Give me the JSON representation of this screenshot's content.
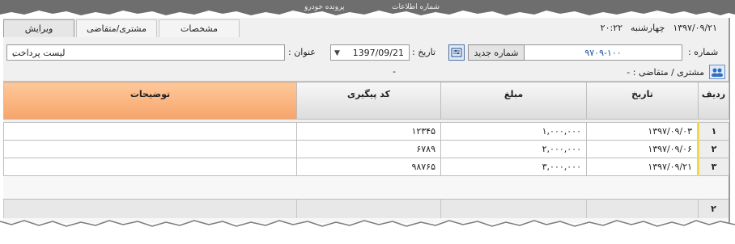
{
  "top_tabs": [
    "پرونده خودرو",
    "شماره اطلاعات"
  ],
  "tabs": [
    {
      "label": "ویرایش",
      "active": true
    },
    {
      "label": "مشتری/متقاضی",
      "active": false
    },
    {
      "label": "مشخصات",
      "active": false
    }
  ],
  "datetime": {
    "time": "۲۰:۲۲",
    "day": "چهارشنبه",
    "date": "۱۳۹۷/۰۹/۲۱"
  },
  "form": {
    "number_label": "شماره :",
    "number_value": "۹۷۰۹-۱۰۰",
    "new_number_button": "شماره جدید",
    "date_label": "تاریخ :",
    "date_value": "1397/09/21",
    "title_label": "عنوان :",
    "title_value": "لیست پرداخت",
    "customer_label": "مشتری / متقاضی : -",
    "dash": "-"
  },
  "grid": {
    "columns": [
      "ردیف",
      "تاریخ",
      "مبلغ",
      "کد پیگیری",
      "توضیحات"
    ],
    "rows": [
      {
        "n": "۱",
        "date": "۱۳۹۷/۰۹/۰۳",
        "amount": "۱,۰۰۰,۰۰۰",
        "code": "۱۲۳۴۵",
        "desc": ""
      },
      {
        "n": "۲",
        "date": "۱۳۹۷/۰۹/۰۶",
        "amount": "۲,۰۰۰,۰۰۰",
        "code": "۶۷۸۹",
        "desc": ""
      },
      {
        "n": "۳",
        "date": "۱۳۹۷/۰۹/۲۱",
        "amount": "۳,۰۰۰,۰۰۰",
        "code": "۹۸۷۶۵",
        "desc": ""
      }
    ],
    "footer_count": "۲"
  },
  "colors": {
    "header_selected": "#f6a46a",
    "row_marker": "#f2d84b",
    "accent_blue": "#2255aa"
  }
}
